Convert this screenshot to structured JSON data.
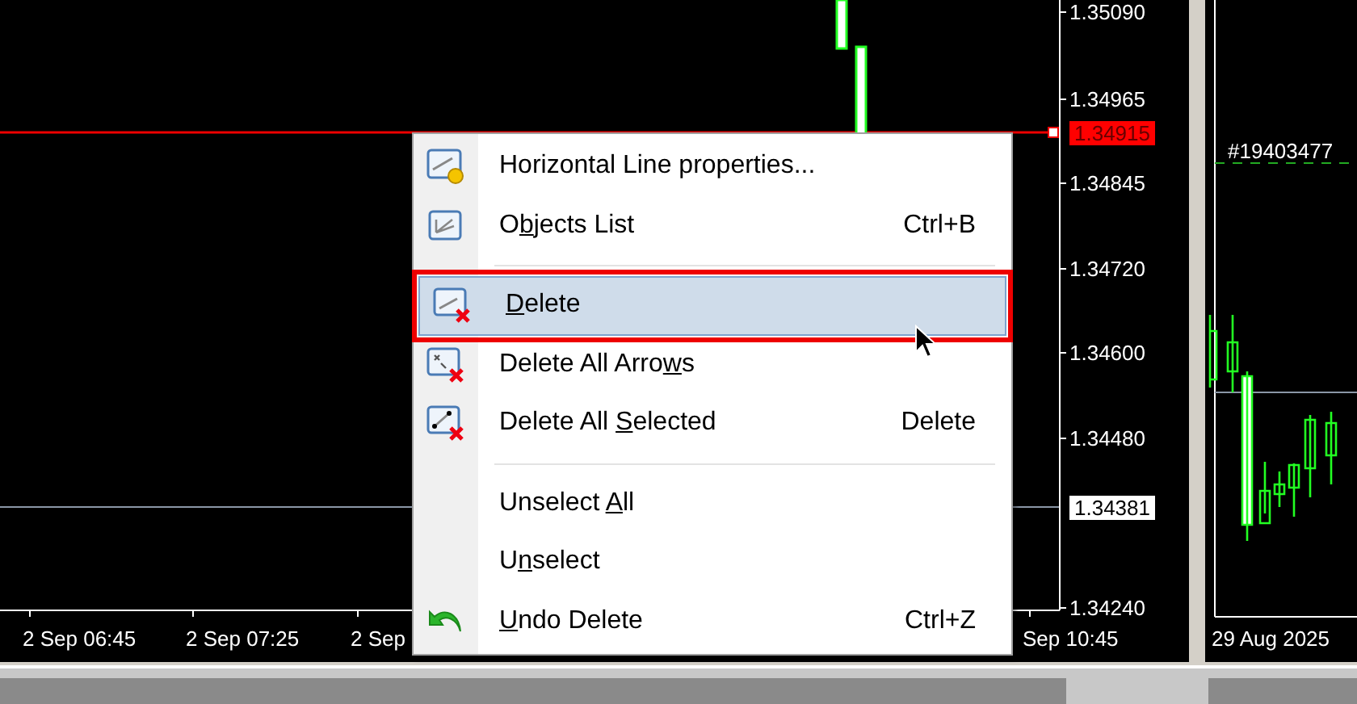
{
  "price_axis": [
    {
      "text": "1.35090",
      "kind": "tick"
    },
    {
      "text": "1.34965",
      "kind": "tick"
    },
    {
      "text": "1.34915",
      "kind": "linemarker"
    },
    {
      "text": "1.34845",
      "kind": "tick"
    },
    {
      "text": "1.34720",
      "kind": "tick"
    },
    {
      "text": "1.34600",
      "kind": "tick"
    },
    {
      "text": "1.34480",
      "kind": "tick"
    },
    {
      "text": "1.34381",
      "kind": "currentmarker"
    },
    {
      "text": "1.34240",
      "kind": "tick"
    }
  ],
  "time_axis": [
    "2 Sep 06:45",
    "2 Sep 07:25",
    "2 Sep",
    "Sep 10:45"
  ],
  "right_chart": {
    "order_label": "#19403477",
    "time_axis": [
      "29 Aug 2025"
    ]
  },
  "context_menu": [
    [
      {
        "kind": "properties",
        "label": "Horizontal Line properties...",
        "selected": false,
        "annotated": false
      },
      {
        "kind": "list",
        "before": "O",
        "key": "b",
        "after": "jects List",
        "shortcut": "Ctrl+B",
        "selected": false,
        "annotated": false
      }
    ],
    [
      {
        "kind": "delete",
        "key": "D",
        "after": "elete",
        "selected": true,
        "annotated": true
      },
      {
        "kind": "deletearrows",
        "before": "Delete All Arro",
        "key": "w",
        "after": "s",
        "selected": false,
        "annotated": false
      },
      {
        "kind": "deleteselected",
        "before": "Delete All ",
        "key": "S",
        "after": "elected",
        "shortcut": "Delete",
        "selected": false,
        "annotated": false
      }
    ],
    [
      {
        "kind": "plain",
        "before": "Unselect ",
        "key": "A",
        "after": "ll",
        "selected": false,
        "annotated": false
      },
      {
        "kind": "plain",
        "before": "U",
        "key": "n",
        "after": "select",
        "selected": false,
        "annotated": false
      },
      {
        "kind": "undo",
        "key": "U",
        "after": "ndo Delete",
        "shortcut": "Ctrl+Z",
        "selected": false,
        "annotated": false
      }
    ]
  ]
}
